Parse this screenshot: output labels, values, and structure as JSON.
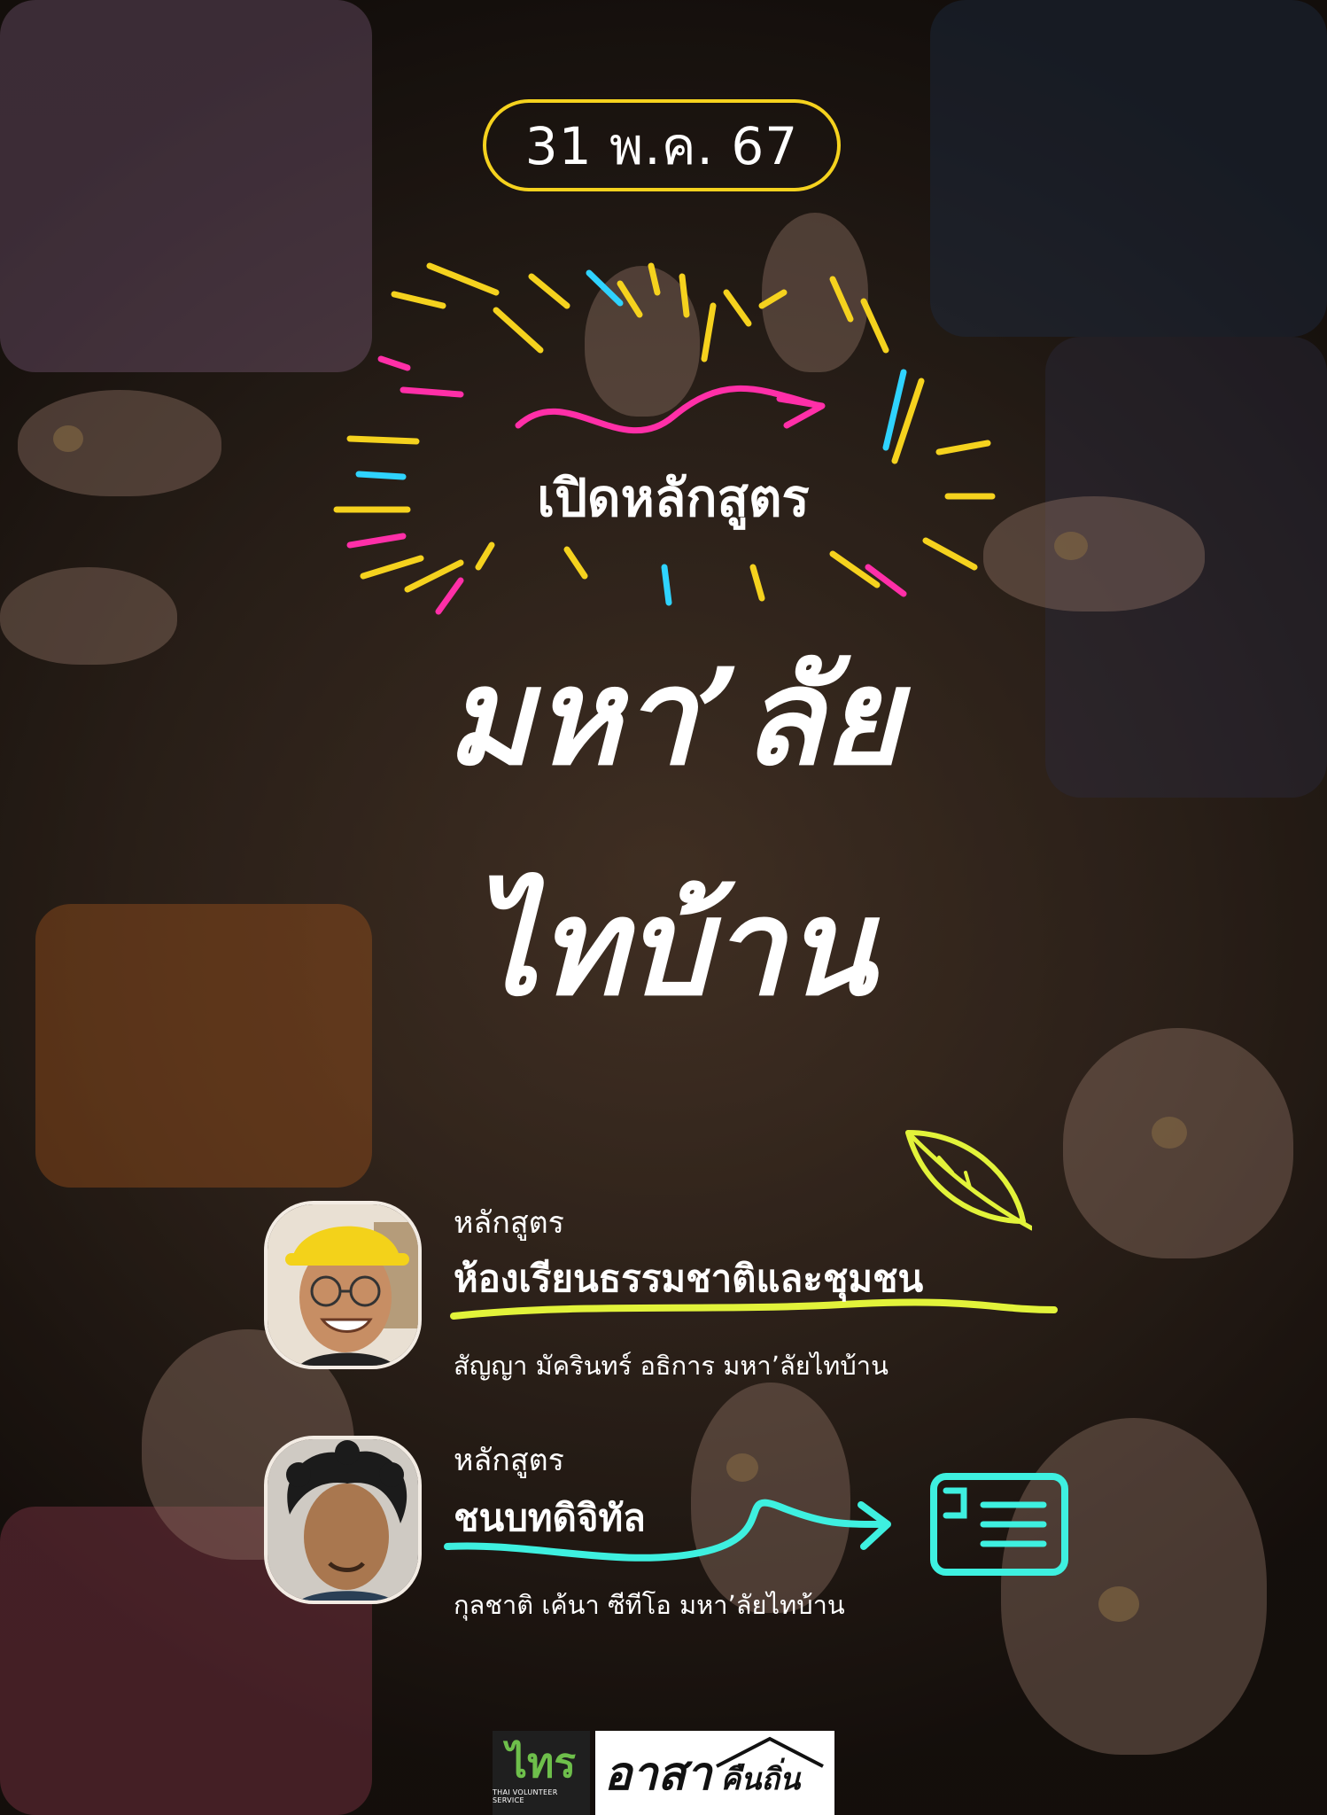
{
  "date": "31 พ.ค. 67",
  "headline": {
    "open": "เปิดหลักสูตร",
    "title_line1": "มหา’ลัย",
    "title_line2": "ไทบ้าน"
  },
  "courses": [
    {
      "label": "หลักสูตร",
      "name": "ห้องเรียนธรรมชาติและชุมชน",
      "person": "สัญญา มัครินทร์ อธิการ มหา’ลัยไทบ้าน",
      "accent": "#e2f33a",
      "icon": "leaf-icon"
    },
    {
      "label": "หลักสูตร",
      "name": "ชนบทดิจิทัล",
      "person": "กุลชาติ เค้นา ซีทีโอ มหา’ลัยไทบ้าน",
      "accent": "#3ef0e0",
      "icon": "document-icon"
    }
  ],
  "logos": {
    "tvs_mark": "ไทร",
    "tvs_sub": "THAI VOLUNTEER SERVICE",
    "asa": "อาสา",
    "asa_local": "คืนถิ่น"
  },
  "colors": {
    "yellow": "#f5d21e",
    "pink": "#ff2fa8",
    "cyan": "#2fd3ff",
    "lime": "#e2f33a",
    "aqua": "#3ef0e0"
  }
}
